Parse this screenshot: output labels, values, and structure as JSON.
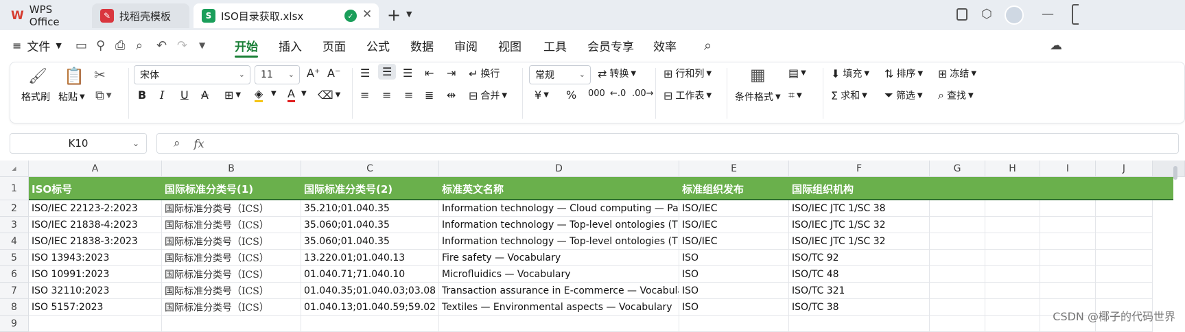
{
  "tabs": [
    {
      "label": "WPS Office",
      "icon": "wps-logo-icon"
    },
    {
      "label": "找稻壳模板",
      "icon": "docer-icon"
    },
    {
      "label": "ISO目录获取.xlsx",
      "icon": "sheet-icon"
    }
  ],
  "menu": {
    "file": "文件",
    "items": [
      "开始",
      "插入",
      "页面",
      "公式",
      "数据",
      "审阅",
      "视图",
      "工具",
      "会员专享",
      "效率"
    ],
    "active": "开始"
  },
  "ribbon": {
    "format_painter": "格式刷",
    "paste": "粘贴",
    "font_name": "宋体",
    "font_size": "11",
    "wrap": "换行",
    "merge": "合并",
    "number_format": "常规",
    "convert": "转换",
    "row_col": "行和列",
    "worksheet": "工作表",
    "cond_format": "条件格式",
    "fill": "填充",
    "sort": "排序",
    "freeze": "冻结",
    "sum": "求和",
    "filter": "筛选",
    "find": "查找"
  },
  "formula": {
    "cell_ref": "K10",
    "fx": "fx",
    "value": ""
  },
  "columns": [
    "A",
    "B",
    "C",
    "D",
    "E",
    "F",
    "G",
    "H",
    "I",
    "J"
  ],
  "rows": [
    "1",
    "2",
    "3",
    "4",
    "5",
    "6",
    "7",
    "8",
    "9"
  ],
  "table": {
    "headers": [
      "ISO标号",
      "国际标准分类号(1)",
      "国际标准分类号(2)",
      "标准英文名称",
      "标准组织发布",
      "国际组织机构"
    ],
    "rows": [
      [
        "ISO/IEC 22123-2:2023",
        "国际标准分类号（ICS）",
        "35.210;01.040.35",
        "Information technology — Cloud computing — Part",
        "ISO/IEC",
        "ISO/IEC JTC 1/SC 38"
      ],
      [
        "ISO/IEC 21838-4:2023",
        "国际标准分类号（ICS）",
        "35.060;01.040.35",
        "Information technology — Top-level ontologies (TL",
        "ISO/IEC",
        "ISO/IEC JTC 1/SC 32"
      ],
      [
        "ISO/IEC 21838-3:2023",
        "国际标准分类号（ICS）",
        "35.060;01.040.35",
        "Information technology — Top-level ontologies (TL",
        "ISO/IEC",
        "ISO/IEC JTC 1/SC 32"
      ],
      [
        "ISO 13943:2023",
        "国际标准分类号（ICS）",
        "13.220.01;01.040.13",
        "Fire safety — Vocabulary",
        "ISO",
        "ISO/TC 92"
      ],
      [
        "ISO 10991:2023",
        "国际标准分类号（ICS）",
        "01.040.71;71.040.10",
        "Microfluidics — Vocabulary",
        "ISO",
        "ISO/TC 48"
      ],
      [
        "ISO 32110:2023",
        "国际标准分类号（ICS）",
        "01.040.35;01.040.03;03.08",
        "Transaction assurance in E-commerce — Vocabulary",
        "ISO",
        "ISO/TC 321"
      ],
      [
        "ISO 5157:2023",
        "国际标准分类号（ICS）",
        "01.040.13;01.040.59;59.02",
        "Textiles — Environmental aspects — Vocabulary",
        "ISO",
        "ISO/TC 38"
      ]
    ]
  },
  "watermark": "CSDN @椰子的代码世界",
  "colors": {
    "header_green": "#6ab04c",
    "accent": "#1a7f37"
  }
}
